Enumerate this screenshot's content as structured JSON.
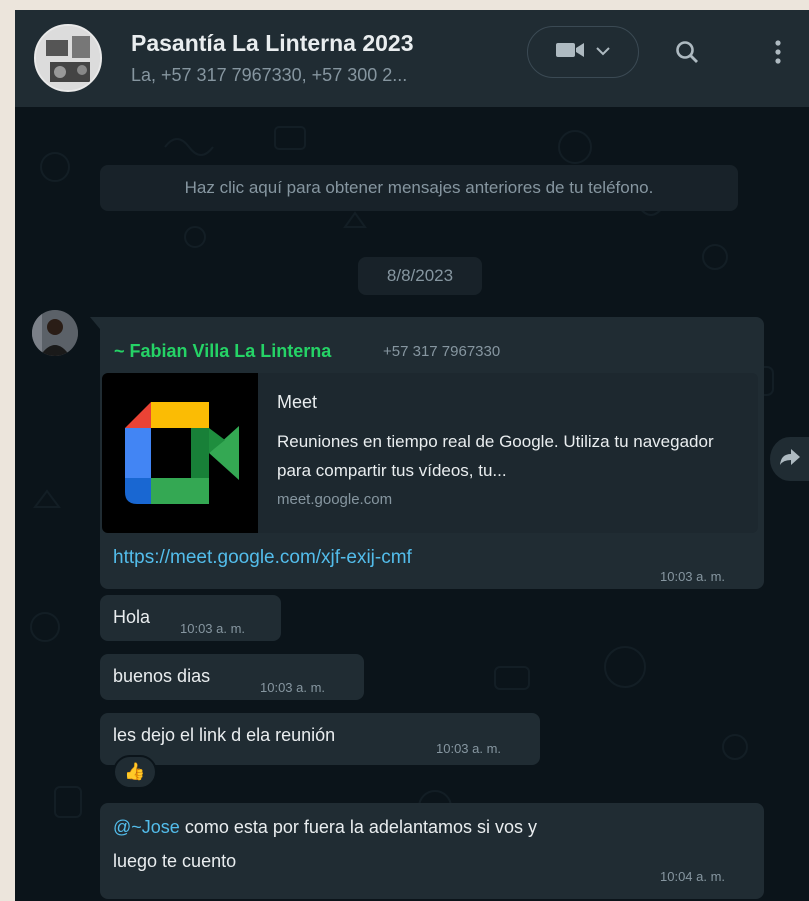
{
  "header": {
    "title": "Pasantía La Linterna 2023",
    "subtitle": "La, +57 317 7967330, +57 300 2..."
  },
  "chat": {
    "load_older": "Haz clic aquí para obtener mensajes anteriores de tu teléfono.",
    "date": "8/8/2023",
    "messages": [
      {
        "sender": "~ Fabian Villa La Linterna",
        "phone": "+57 317 7967330",
        "preview": {
          "title": "Meet",
          "description": "Reuniones en tiempo real de Google. Utiliza tu navegador para compartir tus vídeos, tu...",
          "domain": "meet.google.com"
        },
        "text": "https://meet.google.com/xjf-exij-cmf",
        "time": "10:03 a. m."
      },
      {
        "text": "Hola",
        "time": "10:03 a. m."
      },
      {
        "text": "buenos dias",
        "time": "10:03 a. m."
      },
      {
        "text": "les dejo el link d ela reunión",
        "time": "10:03 a. m.",
        "reaction": "👍"
      },
      {
        "mention": "@~Jose",
        "text_line1": " como esta por fuera la adelantamos si vos y",
        "text_line2": "luego te cuento",
        "time": "10:04 a. m."
      }
    ]
  },
  "colors": {
    "header_bg": "#202c33",
    "chat_bg": "#0b141a",
    "bubble_bg": "#202c33",
    "sender_name": "#25d366",
    "link": "#53bdeb",
    "muted": "#8696a0"
  },
  "icons": [
    "video-icon",
    "chevron-down-icon",
    "search-icon",
    "menu-icon",
    "forward-icon"
  ]
}
